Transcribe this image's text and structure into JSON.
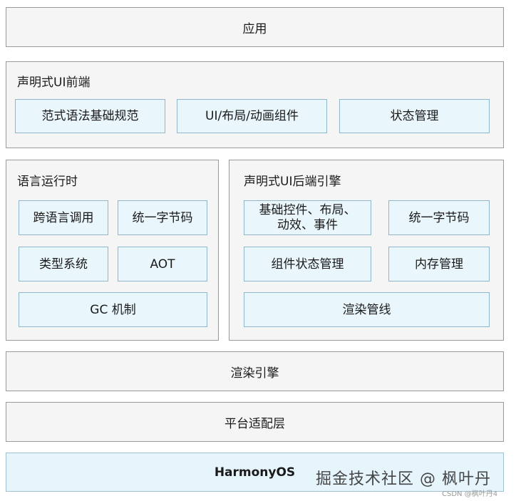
{
  "layers": {
    "app": "应用",
    "frontend": {
      "title": "声明式UI前端",
      "items": [
        "范式语法基础规范",
        "UI/布局/动画组件",
        "状态管理"
      ]
    },
    "runtime": {
      "title": "语言运行时",
      "items": [
        "跨语言调用",
        "统一字节码",
        "类型系统",
        "AOT",
        "GC 机制"
      ]
    },
    "backend": {
      "title": "声明式UI后端引擎",
      "items": [
        "基础控件、布局、\n动效、事件",
        "统一字节码",
        "组件状态管理",
        "内存管理",
        "渲染管线"
      ]
    },
    "render": "渲染引擎",
    "platform": "平台适配层",
    "os": "HarmonyOS"
  },
  "watermark": {
    "main": "掘金技术社区 @ 枫叶丹",
    "small": "CSDN @枫叶丹4"
  }
}
